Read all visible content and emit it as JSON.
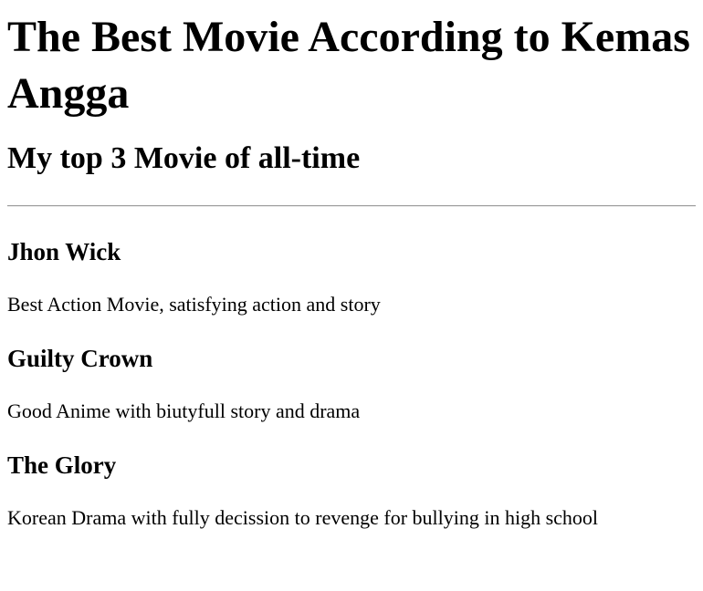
{
  "page": {
    "title": "The Best Movie According to Kemas Angga",
    "subtitle": "My top 3 Movie of all-time"
  },
  "movies": [
    {
      "title": "Jhon Wick",
      "description": "Best Action Movie, satisfying action and story"
    },
    {
      "title": "Guilty Crown",
      "description": "Good Anime with biutyfull story and drama"
    },
    {
      "title": "The Glory",
      "description": "Korean Drama with fully decission to revenge for bullying in high school"
    }
  ]
}
